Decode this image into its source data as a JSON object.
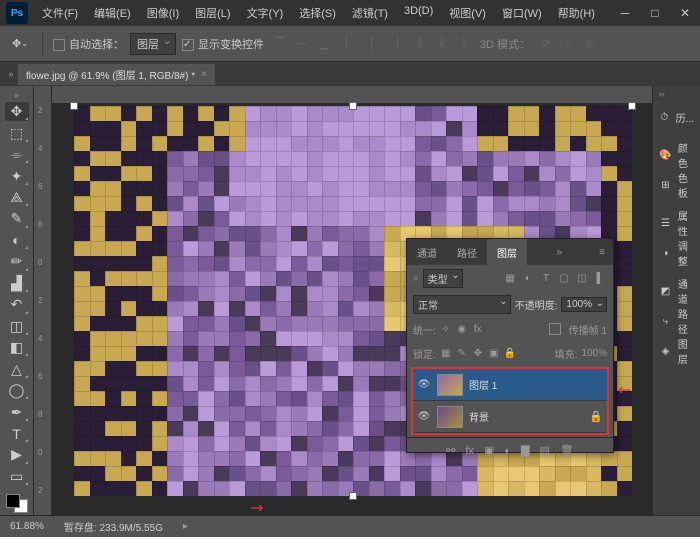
{
  "menu": [
    "文件(F)",
    "编辑(E)",
    "图像(I)",
    "图层(L)",
    "文字(Y)",
    "选择(S)",
    "滤镜(T)",
    "3D(D)",
    "视图(V)",
    "窗口(W)",
    "帮助(H)"
  ],
  "options": {
    "auto_select": "自动选择：",
    "auto_select_target": "图层",
    "show_transform": "显示变换控件",
    "mode_3d_label": "3D 模式："
  },
  "doc_tab": {
    "title": "flowe.jpg @ 61.9% (图层 1, RGB/8#) *"
  },
  "dock": {
    "history": "历...",
    "color": "颜色",
    "swatches": "色板",
    "properties": "属性",
    "adjustments": "调整",
    "channels": "通道",
    "paths": "路径",
    "layers": "图层"
  },
  "layers_panel": {
    "tabs": [
      "通道",
      "路径",
      "图层"
    ],
    "type_filter": "类型",
    "blend_mode": "正常",
    "opacity_label": "不透明度:",
    "opacity_value": "100%",
    "unify_label": "统一:",
    "propagate_label": "传播帧 1",
    "lock_label": "锁定:",
    "fill_label": "填充:",
    "fill_value": "100%",
    "layer1": "图层 1",
    "background": "背景"
  },
  "status": {
    "zoom": "61.88%",
    "scratch": "暂存盘: 233.9M/5.55G"
  },
  "ruler_v": [
    "2",
    "4",
    "6",
    "8",
    "0",
    "2",
    "4",
    "6",
    "8",
    "0",
    "2"
  ]
}
